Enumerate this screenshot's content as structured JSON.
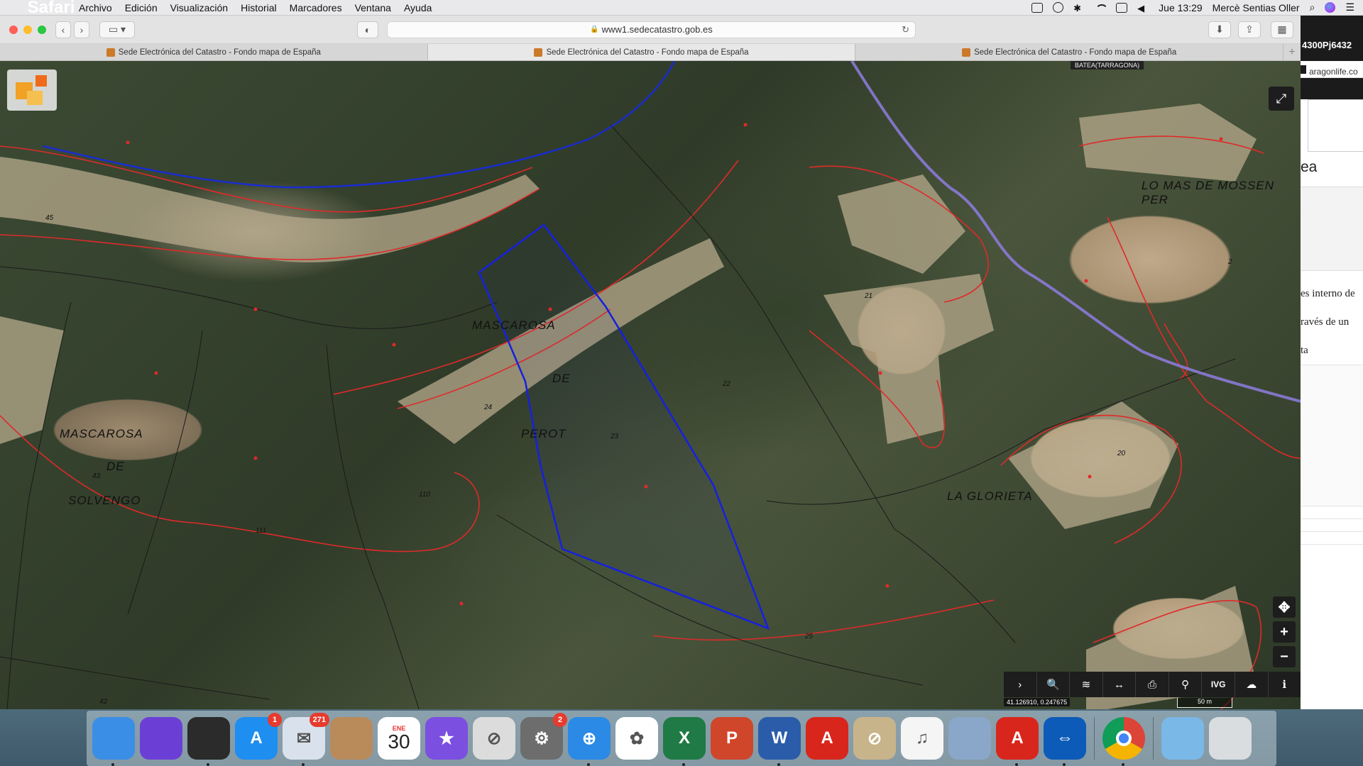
{
  "menubar": {
    "apple": "",
    "items": [
      "Safari",
      "Archivo",
      "Edición",
      "Visualización",
      "Historial",
      "Marcadores",
      "Ventana",
      "Ayuda"
    ],
    "clock": "Jue 13:29",
    "user": "Mercè Sentias Oller"
  },
  "toolbar": {
    "url": "www1.sedecatastro.gob.es"
  },
  "tabs": [
    {
      "label": "Sede Electrónica del Catastro - Fondo mapa de España"
    },
    {
      "label": "Sede Electrónica del Catastro - Fondo mapa de España"
    },
    {
      "label": "Sede Electrónica del Catastro - Fondo mapa de España"
    }
  ],
  "map": {
    "municipality": "BATEA(TARRAGONA)",
    "coordinates": "41.126910, 0.247675",
    "scale": "50 m",
    "labels": [
      "MASCAROSA",
      "DE",
      "PEROT",
      "MASCAROSA",
      "DE",
      "SOLVENGO",
      "LA GLORIETA",
      "LO MAS DE MOSSEN PER"
    ],
    "parcel_numbers": [
      "45",
      "24",
      "23",
      "22",
      "21",
      "20",
      "43",
      "110",
      "111",
      "25",
      "2",
      "42"
    ],
    "controls": {
      "zoom_in": "+",
      "zoom_out": "−",
      "locate": "✥",
      "fullscreen": "⤢"
    },
    "toolbar_buttons": [
      "›",
      "🔍",
      "≋",
      "↔",
      "⎙",
      "⚲",
      "IVG",
      "☁",
      "ℹ"
    ]
  },
  "side_window": {
    "title": "4300Pj6432",
    "address": "aragonlife.co",
    "heading": "ea",
    "lines": [
      "es interno de",
      "ravés de un",
      "ta"
    ]
  },
  "dock": {
    "apps": [
      {
        "name": "Finder",
        "label": "",
        "color": "#3a8ee6"
      },
      {
        "name": "Siri",
        "label": "",
        "color": "#6b3fd6"
      },
      {
        "name": "Photo Booth",
        "label": "",
        "color": "#2b2b2b"
      },
      {
        "name": "App Store",
        "label": "A",
        "color": "#1e8ef0",
        "badge": "1"
      },
      {
        "name": "Mail",
        "label": "✉",
        "color": "#d9e2ec",
        "badge": "271"
      },
      {
        "name": "Contacts",
        "label": "",
        "color": "#b98b5b"
      },
      {
        "name": "Calendar",
        "label": "30",
        "month": "ENE",
        "color": "#ffffff"
      },
      {
        "name": "iMovie",
        "label": "★",
        "color": "#7b4fe0"
      },
      {
        "name": "Prohibited",
        "label": "⊘",
        "color": "#dcdcdc"
      },
      {
        "name": "System Preferences",
        "label": "⚙",
        "color": "#6d6d6d",
        "badge": "2"
      },
      {
        "name": "Safari",
        "label": "⊕",
        "color": "#2a8ae6"
      },
      {
        "name": "Photos",
        "label": "✿",
        "color": "#ffffff"
      },
      {
        "name": "Excel",
        "label": "X",
        "color": "#1f7a45"
      },
      {
        "name": "PowerPoint",
        "label": "P",
        "color": "#d0462b"
      },
      {
        "name": "Word",
        "label": "W",
        "color": "#2a5caa"
      },
      {
        "name": "Acrobat",
        "label": "A",
        "color": "#d8261c"
      },
      {
        "name": "Prohibited 2",
        "label": "⊘",
        "color": "#c8b48a"
      },
      {
        "name": "Music",
        "label": "♫",
        "color": "#f5f5f5"
      },
      {
        "name": "Preview",
        "label": "",
        "color": "#8aa7c9"
      },
      {
        "name": "Acrobat Reader",
        "label": "A",
        "color": "#d8261c"
      },
      {
        "name": "TeamViewer",
        "label": "⇔",
        "color": "#0d5bb8"
      },
      {
        "name": "Chrome",
        "label": "",
        "color": "#ffffff"
      },
      {
        "name": "Applications Folder",
        "label": "",
        "color": "#7ab8e8"
      },
      {
        "name": "Trash",
        "label": "",
        "color": "#d9dde0"
      }
    ]
  }
}
